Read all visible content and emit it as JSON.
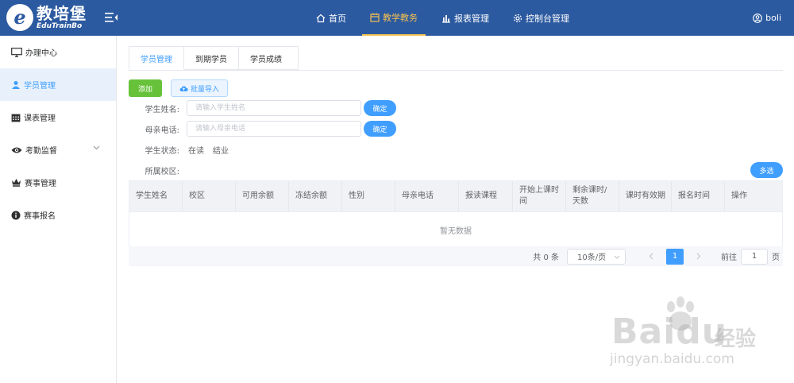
{
  "header": {
    "logo_cn": "教培堡",
    "logo_en": "EduTrainBo",
    "nav": [
      {
        "label": "首页"
      },
      {
        "label": "教学教务"
      },
      {
        "label": "报表管理"
      },
      {
        "label": "控制台管理"
      }
    ],
    "user": "boli",
    "accent": "#f5c150",
    "bg": "#2c5aa0"
  },
  "sidebar": {
    "items": [
      {
        "label": "办理中心",
        "icon": "monitor-icon"
      },
      {
        "label": "学员管理",
        "icon": "students-icon"
      },
      {
        "label": "课表管理",
        "icon": "calendar-icon"
      },
      {
        "label": "考勤监督",
        "icon": "eye-icon"
      },
      {
        "label": "赛事管理",
        "icon": "crown-icon"
      },
      {
        "label": "赛事报名",
        "icon": "info-icon"
      }
    ]
  },
  "tabs": [
    {
      "label": "学员管理"
    },
    {
      "label": "到期学员"
    },
    {
      "label": "学员成绩"
    }
  ],
  "toolbar": {
    "add_label": "添加",
    "import_label": "批量导入"
  },
  "filters": {
    "student_name_label": "学生姓名:",
    "student_name_placeholder": "请输入学生姓名",
    "mother_phone_label": "母亲电话:",
    "mother_phone_placeholder": "请输入母亲电话",
    "confirm_label": "确定",
    "status_label": "学生状态:",
    "status_options": [
      "在读",
      "结业"
    ],
    "campus_label": "所属校区:",
    "multi_label": "多选"
  },
  "table": {
    "columns": [
      "学生姓名",
      "校区",
      "可用余额",
      "冻结余额",
      "性别",
      "母亲电话",
      "报读课程",
      "开始上课时\n间",
      "剩余课时/\n天数",
      "课时有效期",
      "报名时间",
      "操作"
    ],
    "empty_text": "暂无数据"
  },
  "pager": {
    "total": "共 0 条",
    "page_size": "10条/页",
    "current_page": "1",
    "goto_label": "前往",
    "goto_value": "1",
    "page_suffix": "页"
  },
  "watermark": {
    "main": "Baidu",
    "cn": "经验",
    "sub": "jingyan.baidu.com"
  },
  "colors": {
    "primary": "#409eff",
    "success": "#67c23a"
  }
}
